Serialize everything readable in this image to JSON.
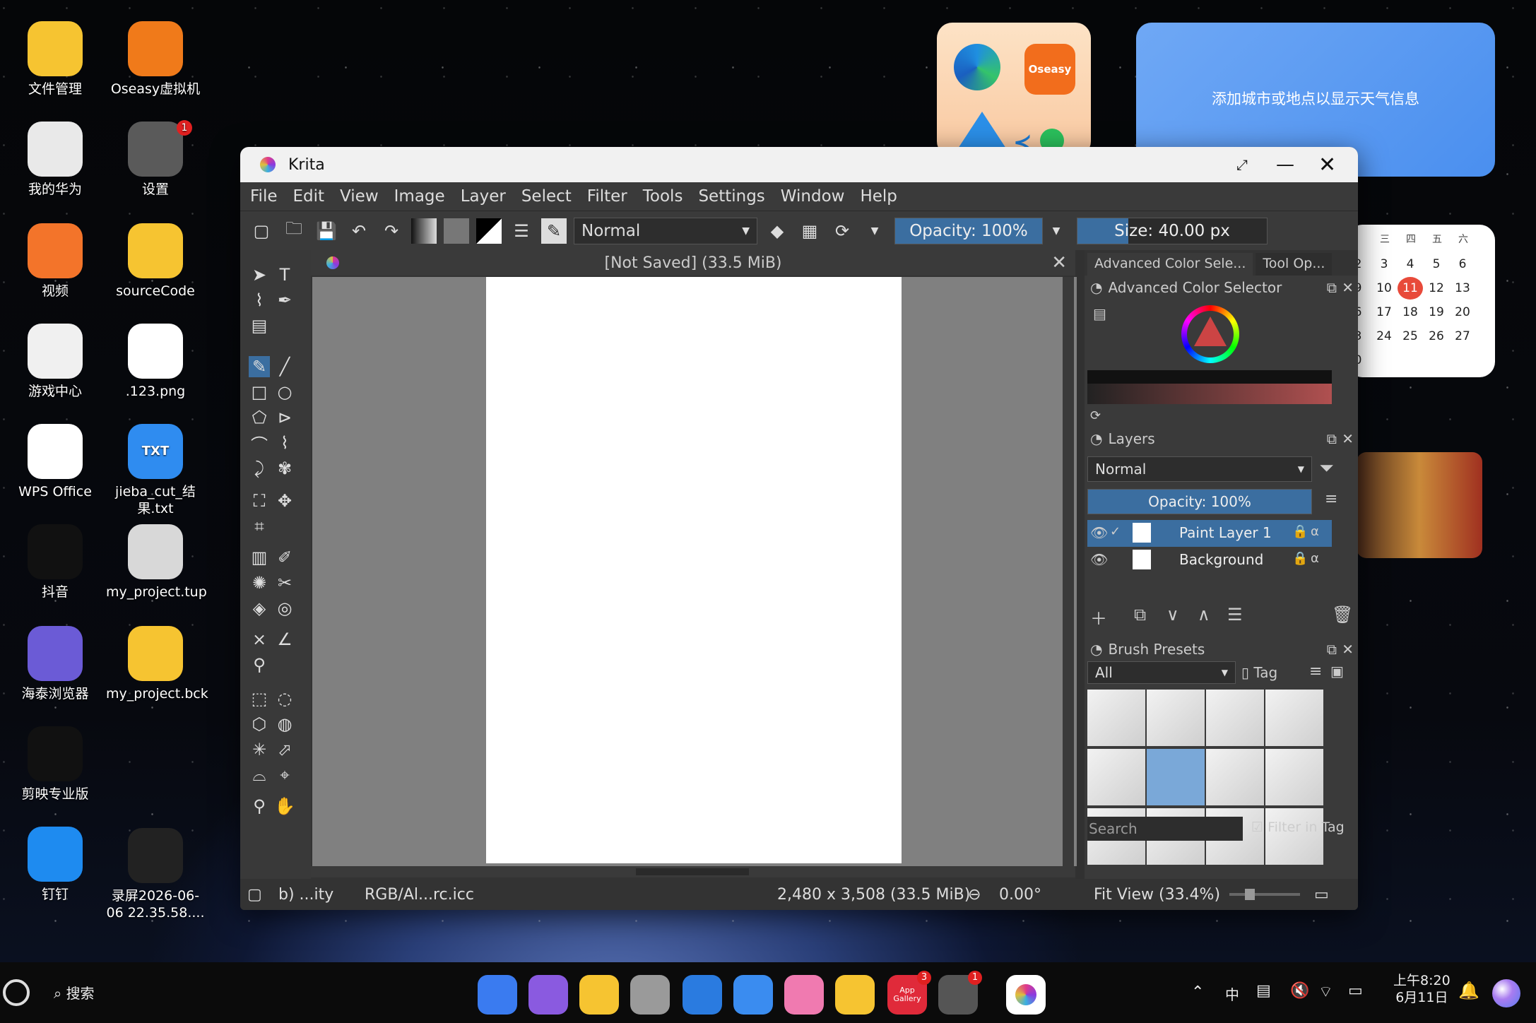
{
  "desktop": {
    "icons": [
      {
        "label": "文件管理",
        "color": "#f6c431"
      },
      {
        "label": "Oseasy虚拟机",
        "color": "#f07a1a"
      },
      {
        "label": "我的华为",
        "color": "#e9e9e9"
      },
      {
        "label": "设置",
        "color": "#5a5a5a",
        "badge": "1"
      },
      {
        "label": "视频",
        "color": "#f3742a"
      },
      {
        "label": "sourceCode",
        "color": "#f6c431"
      },
      {
        "label": "游戏中心",
        "color": "#f0f0f0"
      },
      {
        "label": ".123.png",
        "color": "#ffffff"
      },
      {
        "label": "WPS Office",
        "color": "#ffffff"
      },
      {
        "label": "jieba_cut_结果.txt",
        "color": "#2f8cf0",
        "glyph": "TXT"
      },
      {
        "label": "抖音",
        "color": "#111111"
      },
      {
        "label": "my_project.tup",
        "color": "#d8d8d8"
      },
      {
        "label": "海泰浏览器",
        "color": "#6b5bd6"
      },
      {
        "label": "my_project.bck",
        "color": "#f6c431"
      },
      {
        "label": "剪映专业版",
        "color": "#111111"
      },
      {
        "label": "录屏2026-06-06 22.35.58....",
        "color": "#222222"
      },
      {
        "label": "钉钉",
        "color": "#1e8bf0"
      }
    ],
    "weather_text": "添加城市或地点以显示天气信息",
    "oseasy_label": "Oseasy",
    "calendar": {
      "header": [
        "三",
        "四",
        "五",
        "六"
      ],
      "rows": [
        [
          "2",
          "3",
          "4",
          "5",
          "6"
        ],
        [
          "9",
          "10",
          "11",
          "12",
          "13"
        ],
        [
          "6",
          "17",
          "18",
          "19",
          "20"
        ],
        [
          "3",
          "24",
          "25",
          "26",
          "27"
        ],
        [
          "0"
        ]
      ],
      "today": "11"
    }
  },
  "krita": {
    "title": "Krita",
    "menu": [
      "File",
      "Edit",
      "View",
      "Image",
      "Layer",
      "Select",
      "Filter",
      "Tools",
      "Settings",
      "Window",
      "Help"
    ],
    "toolbar": {
      "blend_mode": "Normal",
      "opacity": "Opacity: 100%",
      "opacity_fraction": 1.0,
      "size": "Size: 40.00 px",
      "size_fraction": 0.27
    },
    "document_tab": "[Not Saved]  (33.5 MiB)",
    "dock_tabs": [
      "Advanced Color Sele...",
      "Tool Op..."
    ],
    "color_selector_title": "Advanced Color Selector",
    "layers": {
      "title": "Layers",
      "blend_mode": "Normal",
      "opacity": "Opacity: 100%",
      "items": [
        {
          "name": "Paint Layer 1",
          "selected": true
        },
        {
          "name": "Background",
          "selected": false
        }
      ]
    },
    "brush_presets": {
      "title": "Brush Presets",
      "filter": "All",
      "tag": "Tag",
      "search": "Search",
      "filter_in_tag": "Filter in Tag"
    },
    "status": {
      "profile": "b) ...ity",
      "color_space": "RGB/Al...rc.icc",
      "dimensions": "2,480 x 3,508 (33.5 MiB)",
      "rotation": "0.00°",
      "zoom": "Fit View (33.4%)"
    }
  },
  "taskbar": {
    "search": "搜索",
    "time": "上午8:20",
    "date": "6月11日",
    "app_gallery_label": "App Gallery",
    "app_gallery_badge": "3",
    "settings_badge": "1",
    "ime": "中"
  }
}
